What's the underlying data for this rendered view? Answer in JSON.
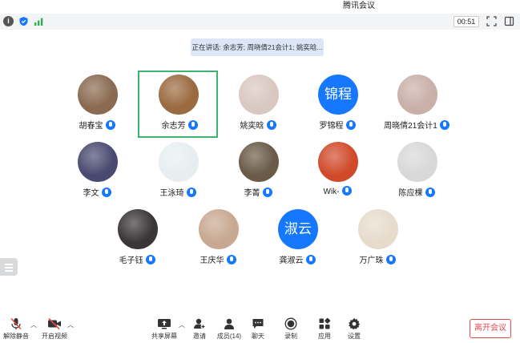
{
  "window": {
    "title": "腾讯会议"
  },
  "status": {
    "timer": "00:51"
  },
  "banner": {
    "speaking": "正在讲话: 余志芳; 周晓倩21会计1; 姚奕晗..."
  },
  "participants": [
    {
      "name": "胡春宝",
      "avatar_text": "",
      "color": "#8a6a50"
    },
    {
      "name": "余志芳",
      "avatar_text": "",
      "color": "#9a6a40"
    },
    {
      "name": "姚奕晗",
      "avatar_text": "",
      "color": "#d8c8c0"
    },
    {
      "name": "罗锦程",
      "avatar_text": "锦程",
      "color": "#1677ff"
    },
    {
      "name": "周晓倩21会计1",
      "avatar_text": "",
      "color": "#c9b0a8"
    },
    {
      "name": "李文",
      "avatar_text": "",
      "color": "#4a4a70"
    },
    {
      "name": "王泳琦",
      "avatar_text": "",
      "color": "#e8eef0"
    },
    {
      "name": "李菁",
      "avatar_text": "",
      "color": "#6a5a48"
    },
    {
      "name": "Wik-",
      "avatar_text": "",
      "color": "#d04a2a"
    },
    {
      "name": "陈应棵",
      "avatar_text": "",
      "color": "#d8d8d8"
    },
    {
      "name": "毛子钰",
      "avatar_text": "",
      "color": "#3a3638"
    },
    {
      "name": "王庆华",
      "avatar_text": "",
      "color": "#c8a890"
    },
    {
      "name": "龚淑云",
      "avatar_text": "淑云",
      "color": "#1677ff"
    },
    {
      "name": "万广珠",
      "avatar_text": "",
      "color": "#e6dccc"
    }
  ],
  "toolbar": {
    "mute": "解除静音",
    "video": "开启视频",
    "share": "共享屏幕",
    "invite": "邀请",
    "members": "成员(14)",
    "chat": "聊天",
    "record": "录制",
    "apps": "应用",
    "settings": "设置",
    "leave": "离开会议"
  }
}
